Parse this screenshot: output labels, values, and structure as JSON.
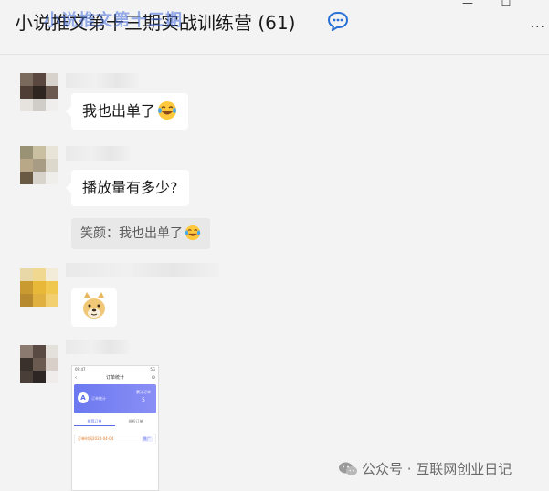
{
  "window": {
    "title": "小说推文第十三期实战训练营 (61)",
    "overlay_watermark": "小说推文第十三期",
    "minimize_icon": "minimize-icon",
    "maximize_icon": "maximize-icon",
    "more_icon": "more-icon",
    "more_glyph": "···",
    "chat_info_icon": "chat-bubble-icon"
  },
  "messages": [
    {
      "type": "text",
      "text": "我也出单了",
      "emoji": "laughing-tears-emoji"
    },
    {
      "type": "text",
      "text": "播放量有多少?"
    },
    {
      "type": "quote",
      "text": "笑颜：我也出单了",
      "emoji": "laughing-tears-emoji"
    },
    {
      "type": "sticker",
      "sticker": "doge-sticker"
    },
    {
      "type": "image",
      "screenshot": {
        "status_left": "09:47",
        "status_right": "5G",
        "nav_back": "‹",
        "nav_title": "订单统计",
        "nav_right": "⊙",
        "banner_label": "订单统计",
        "banner_stat_label": "累计订单",
        "banner_stat_value": "5",
        "tab_1": "推荐订单",
        "tab_2": "授权订单",
        "order_line": "订单时间2024-04-04",
        "order_tag": "推广"
      }
    }
  ],
  "footer_watermark": {
    "icon": "wechat-icon",
    "text": "公众号 · 互联网创业日记"
  },
  "colors": {
    "background": "#f3f3f3",
    "bubble": "#ffffff",
    "quote": "#e8e8e8",
    "banner": "#6b78f0"
  }
}
